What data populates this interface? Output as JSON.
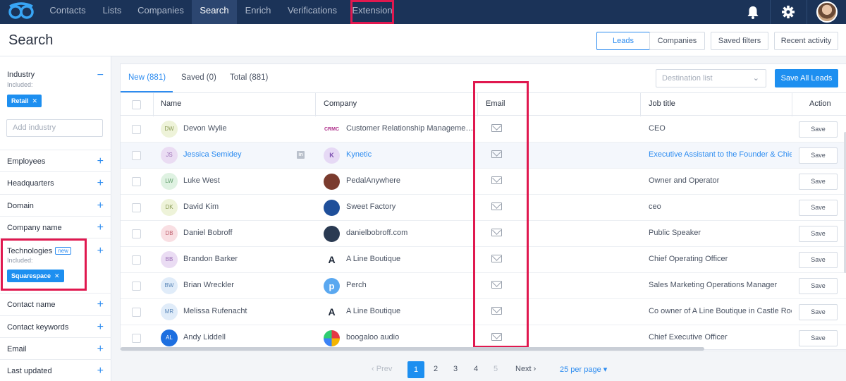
{
  "nav": {
    "items": [
      {
        "label": "Contacts"
      },
      {
        "label": "Lists"
      },
      {
        "label": "Companies"
      },
      {
        "label": "Search"
      },
      {
        "label": "Enrich"
      },
      {
        "label": "Verifications"
      },
      {
        "label": "Extension"
      }
    ],
    "active": "Search",
    "accent": "#1b3358"
  },
  "header": {
    "title": "Search",
    "toggle": {
      "leads": "Leads",
      "companies": "Companies"
    },
    "saved_filters": "Saved filters",
    "recent_activity": "Recent activity"
  },
  "sidebar": {
    "industry": {
      "label": "Industry",
      "sub": "Included:",
      "chip": "Retail",
      "placeholder": "Add industry",
      "collapse_icon": "−"
    },
    "filters": [
      {
        "label": "Employees",
        "icon": "+"
      },
      {
        "label": "Headquarters",
        "icon": "+"
      },
      {
        "label": "Domain",
        "icon": "+"
      },
      {
        "label": "Company name",
        "icon": "+"
      }
    ],
    "technologies": {
      "label": "Technologies",
      "badge": "new",
      "sub": "Included:",
      "chip": "Squarespace",
      "icon": "+"
    },
    "filters2": [
      {
        "label": "Contact name",
        "icon": "+"
      },
      {
        "label": "Contact keywords",
        "icon": "+"
      },
      {
        "label": "Email",
        "icon": "+"
      },
      {
        "label": "Last updated",
        "icon": "+"
      }
    ]
  },
  "tabs": [
    {
      "label": "New (881)"
    },
    {
      "label": "Saved (0)"
    },
    {
      "label": "Total (881)"
    }
  ],
  "destination": {
    "placeholder": "Destination list"
  },
  "save_all": "Save All Leads",
  "table": {
    "columns": {
      "name": "Name",
      "company": "Company",
      "email": "Email",
      "job": "Job title",
      "action": "Action"
    },
    "save_label": "Save",
    "rows": [
      {
        "initials": "DW",
        "name": "Devon Wylie",
        "company": "Customer Relationship Management Consultants",
        "logo": "CRMC",
        "job": "CEO",
        "avatar_bg": "#eef3d9",
        "avatar_fg": "#8a9a55"
      },
      {
        "initials": "JS",
        "name": "Jessica Semidey",
        "company": "Kynetic",
        "logo": "K",
        "job": "Executive Assistant to the Founder & Chief",
        "avatar_bg": "#eadcf3",
        "avatar_fg": "#9a6fb5"
      },
      {
        "initials": "LW",
        "name": "Luke West",
        "company": "PedalAnywhere",
        "logo": "",
        "job": "Owner and Operator",
        "avatar_bg": "#dff2e2",
        "avatar_fg": "#5f9c6a"
      },
      {
        "initials": "DK",
        "name": "David Kim",
        "company": "Sweet Factory",
        "logo": "",
        "job": "ceo",
        "avatar_bg": "#eef3d9",
        "avatar_fg": "#8a9a55"
      },
      {
        "initials": "DB",
        "name": "Daniel Bobroff",
        "company": "danielbobroff.com",
        "logo": "",
        "job": "Public Speaker",
        "avatar_bg": "#f9dfe3",
        "avatar_fg": "#c0616f"
      },
      {
        "initials": "BB",
        "name": "Brandon Barker",
        "company": "A Line Boutique",
        "logo": "A",
        "job": "Chief Operating Officer",
        "avatar_bg": "#eadcf3",
        "avatar_fg": "#9a6fb5"
      },
      {
        "initials": "BW",
        "name": "Brian Wreckler",
        "company": "Perch",
        "logo": "p",
        "job": "Sales Marketing Operations Manager",
        "avatar_bg": "#e0ecf9",
        "avatar_fg": "#5b87b8"
      },
      {
        "initials": "MR",
        "name": "Melissa Rufenacht",
        "company": "A Line Boutique",
        "logo": "A",
        "job": "Co owner of A Line Boutique in Castle Rock",
        "avatar_bg": "#e0ecf9",
        "avatar_fg": "#5b87b8"
      },
      {
        "initials": "AL",
        "name": "Andy Liddell",
        "company": "boogaloo audio",
        "logo": "",
        "job": "Chief Executive Officer",
        "avatar_bg": "#1d6fe0",
        "avatar_fg": "#ffffff"
      }
    ]
  },
  "pagination": {
    "prev": "Prev",
    "pages": [
      "1",
      "2",
      "3",
      "4",
      "5"
    ],
    "next": "Next",
    "per_page": "25 per page"
  }
}
